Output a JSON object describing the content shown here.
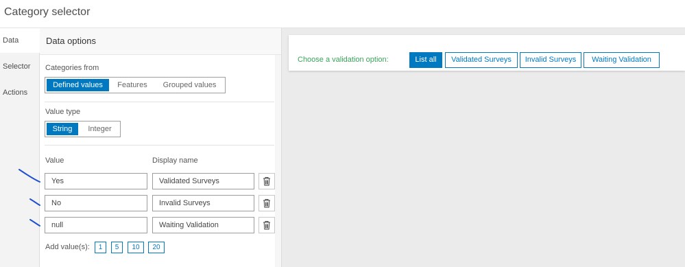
{
  "window": {
    "title": "Category selector"
  },
  "side_tabs": [
    "Data",
    "Selector",
    "Actions"
  ],
  "panel": {
    "header": "Data options",
    "categories_label": "Categories from",
    "categories_options": [
      "Defined values",
      "Features",
      "Grouped values"
    ],
    "value_type_label": "Value type",
    "value_type_options": [
      "String",
      "Integer"
    ],
    "col_value": "Value",
    "col_display": "Display name",
    "rows": [
      {
        "value": "Yes",
        "display": "Validated Surveys"
      },
      {
        "value": "No",
        "display": "Invalid Surveys"
      },
      {
        "value": "null",
        "display": "Waiting Validation"
      }
    ],
    "add_label": "Add value(s):",
    "add_options": [
      "1",
      "5",
      "10",
      "20"
    ]
  },
  "preview": {
    "prompt": "Choose a validation option:",
    "buttons": [
      "List all",
      "Validated Surveys",
      "Invalid Surveys",
      "Waiting Validation"
    ]
  },
  "colors": {
    "accent": "#0079c1",
    "prompt_green": "#3aa35a",
    "annotation_ink": "#1d4fd1"
  }
}
